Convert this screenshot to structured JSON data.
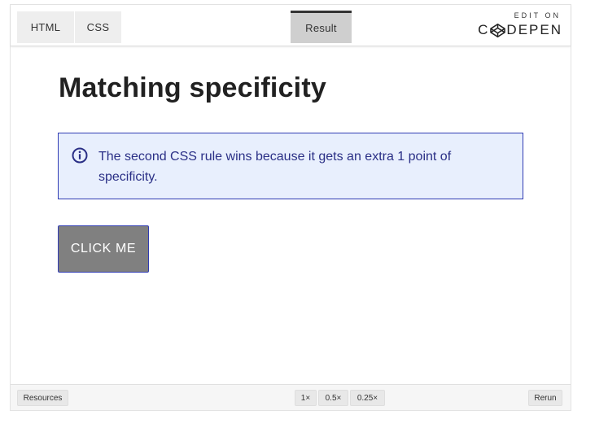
{
  "tabs": {
    "html": "HTML",
    "css": "CSS",
    "result": "Result"
  },
  "codepen": {
    "edit_on": "EDIT ON",
    "brand_prefix": "C",
    "brand_suffix": "DEPEN",
    "logo_icon": "codepen-box-icon"
  },
  "result": {
    "heading": "Matching specificity",
    "callout": {
      "icon": "info-icon",
      "text": "The second CSS rule wins because it gets an extra 1 point of specificity."
    },
    "button_label": "CLICK ME"
  },
  "bottombar": {
    "resources": "Resources",
    "zoom_options": [
      "1×",
      "0.5×",
      "0.25×"
    ],
    "rerun": "Rerun"
  },
  "colors": {
    "callout_bg": "#e8effd",
    "callout_border": "#2f3bb3",
    "callout_text": "#2a2f86",
    "button_bg": "#808080",
    "active_tab": "#cfcfcf"
  }
}
